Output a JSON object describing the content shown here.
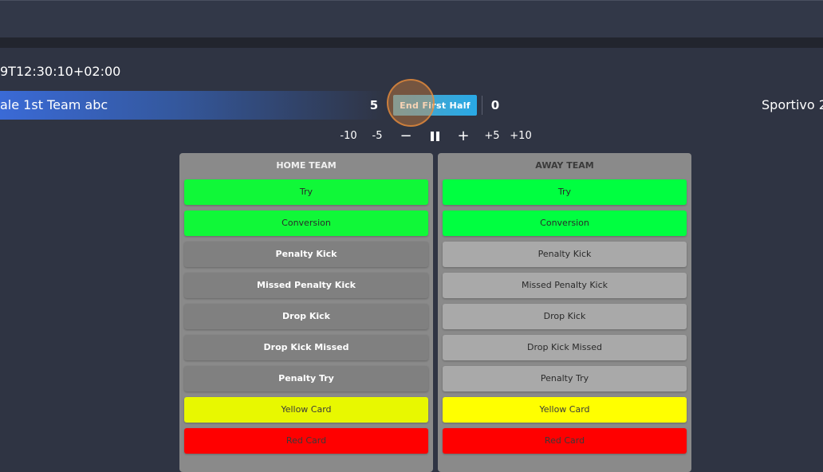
{
  "match": {
    "timestamp": "9T12:30:10+02:00",
    "home_team": "ale 1st Team abc",
    "home_score": "5",
    "away_team": "Sportivo 2",
    "away_score": "0",
    "end_half_label": "End First Half"
  },
  "time_controls": {
    "minus10": "-10",
    "minus5": "-5",
    "minus1": "−",
    "plus1": "+",
    "plus5": "+5",
    "plus10": "+10"
  },
  "home_panel": {
    "title": "HOME TEAM",
    "actions": [
      "Try",
      "Conversion",
      "Penalty Kick",
      "Missed Penalty Kick",
      "Drop Kick",
      "Drop Kick Missed",
      "Penalty Try",
      "Yellow Card",
      "Red Card"
    ]
  },
  "away_panel": {
    "title": "AWAY TEAM",
    "actions": [
      "Try",
      "Conversion",
      "Penalty Kick",
      "Missed Penalty Kick",
      "Drop Kick",
      "Drop Kick Missed",
      "Penalty Try",
      "Yellow Card",
      "Red Card"
    ]
  },
  "colors": {
    "background": "#2f3443",
    "try_green": "#00ff40",
    "yellow_card": "#ffff00",
    "red_card": "#ff0000",
    "accent_blue": "#29a9e6"
  }
}
